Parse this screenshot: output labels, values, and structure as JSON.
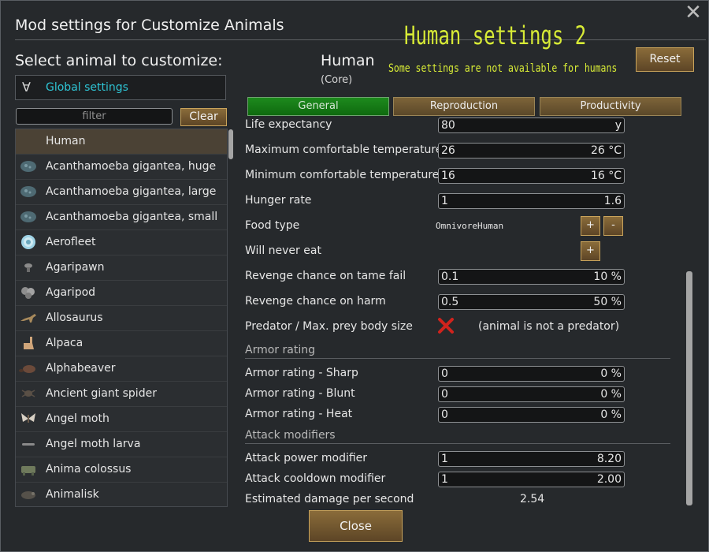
{
  "window": {
    "title": "Mod settings for Customize Animals",
    "close_icon": "close-icon"
  },
  "header": {
    "banner_title": "Human settings 2",
    "banner_subtitle": "Some settings are not available for humans",
    "reset_label": "Reset",
    "banner_color": "#d7ea36"
  },
  "sidebar": {
    "heading": "Select animal to customize:",
    "global_icon": "∀",
    "global_label": "Global settings",
    "filter_placeholder": "filter",
    "filter_value": "",
    "clear_label": "Clear",
    "animals": [
      {
        "label": "Human",
        "icon": "none",
        "selected": true
      },
      {
        "label": "Acanthamoeba gigantea, huge",
        "icon": "amoeba-icon"
      },
      {
        "label": "Acanthamoeba gigantea, large",
        "icon": "amoeba-icon"
      },
      {
        "label": "Acanthamoeba gigantea, small",
        "icon": "amoeba-icon"
      },
      {
        "label": "Aerofleet",
        "icon": "aerofleet-icon"
      },
      {
        "label": "Agaripawn",
        "icon": "agaripawn-icon"
      },
      {
        "label": "Agaripod",
        "icon": "agaripod-icon"
      },
      {
        "label": "Allosaurus",
        "icon": "allosaurus-icon"
      },
      {
        "label": "Alpaca",
        "icon": "alpaca-icon"
      },
      {
        "label": "Alphabeaver",
        "icon": "alphabeaver-icon"
      },
      {
        "label": "Ancient giant spider",
        "icon": "spider-icon"
      },
      {
        "label": "Angel moth",
        "icon": "moth-icon"
      },
      {
        "label": "Angel moth larva",
        "icon": "larva-icon"
      },
      {
        "label": "Anima colossus",
        "icon": "colossus-icon"
      },
      {
        "label": "Animalisk",
        "icon": "animalisk-icon"
      }
    ]
  },
  "selected_animal": {
    "name": "Human",
    "source": "(Core)"
  },
  "tabs": [
    {
      "label": "General",
      "active": true
    },
    {
      "label": "Reproduction",
      "active": false
    },
    {
      "label": "Productivity",
      "active": false
    }
  ],
  "settings": {
    "life_expectancy": {
      "label": "Life expectancy",
      "value": "80",
      "display": "y"
    },
    "max_temp": {
      "label": "Maximum comfortable temperature",
      "value": "26",
      "display": "26 °C"
    },
    "min_temp": {
      "label": "Minimum comfortable temperature",
      "value": "16",
      "display": "16 °C"
    },
    "hunger_rate": {
      "label": "Hunger rate",
      "value": "1",
      "display": "1.6"
    },
    "food_type": {
      "label": "Food type",
      "value": "OmnivoreHuman",
      "add_label": "+",
      "remove_label": "-"
    },
    "never_eat": {
      "label": "Will never eat",
      "add_label": "+"
    },
    "revenge_tame": {
      "label": "Revenge chance on tame fail",
      "value": "0.1",
      "display": "10 %"
    },
    "revenge_harm": {
      "label": "Revenge chance on harm",
      "value": "0.5",
      "display": "50 %"
    },
    "predator": {
      "label": "Predator / Max. prey body size",
      "enabled": false,
      "note": "(animal is not a predator)"
    },
    "armor_heading": "Armor rating",
    "armor_sharp": {
      "label": "Armor rating - Sharp",
      "value": "0",
      "display": "0 %"
    },
    "armor_blunt": {
      "label": "Armor rating - Blunt",
      "value": "0",
      "display": "0 %"
    },
    "armor_heat": {
      "label": "Armor rating - Heat",
      "value": "0",
      "display": "0 %"
    },
    "attack_heading": "Attack modifiers",
    "attack_power": {
      "label": "Attack power modifier",
      "value": "1",
      "display": "8.20"
    },
    "attack_cooldown": {
      "label": "Attack cooldown modifier",
      "value": "1",
      "display": "2.00"
    },
    "dps": {
      "label": "Estimated damage per second",
      "value": "2.54"
    }
  },
  "footer": {
    "close_label": "Close"
  }
}
